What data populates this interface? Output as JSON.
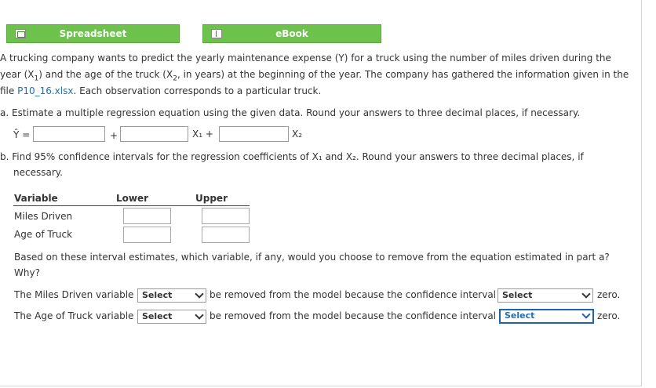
{
  "toolbar": {
    "spreadsheet_label": "Spreadsheet",
    "ebook_label": "eBook",
    "accent": "#6cc24a"
  },
  "problem": {
    "line1": "A trucking company wants to predict the yearly maintenance expense (Y) for a truck using the number of miles driven during the",
    "line2_pre": "year (X",
    "line2_mid": ") and the age of the truck (X",
    "line2_post": ", in years) at the beginning of the year. The company has gathered the information given in the",
    "line3_pre": "file ",
    "file_link": "P10_16.xlsx",
    "line3_post": ". Each observation corresponds to a particular truck."
  },
  "part_a": {
    "prompt": "a. Estimate a multiple regression equation using the given data. Round your answers to three decimal places, if necessary.",
    "yhat": "Ŷ =",
    "plus": "+",
    "x1": "X₁ +",
    "x2": "X₂"
  },
  "part_b": {
    "prompt_line1": "b. Find 95% confidence intervals for the regression coefficients of X₁ and X₂. Round your answers to three decimal places, if",
    "prompt_line2": "necessary.",
    "headers": [
      "Variable",
      "Lower",
      "Upper"
    ],
    "rows": [
      "Miles Driven",
      "Age of Truck"
    ],
    "question_line1": "Based on these interval estimates, which variable, if any, would you choose to remove from the equation estimated in part a?",
    "question_line2": "Why?",
    "miles_pre": "The Miles Driven variable",
    "age_pre": "The Age of Truck variable",
    "mid": "be removed from the model because the confidence interval",
    "post": "zero.",
    "select_label": "Select"
  }
}
